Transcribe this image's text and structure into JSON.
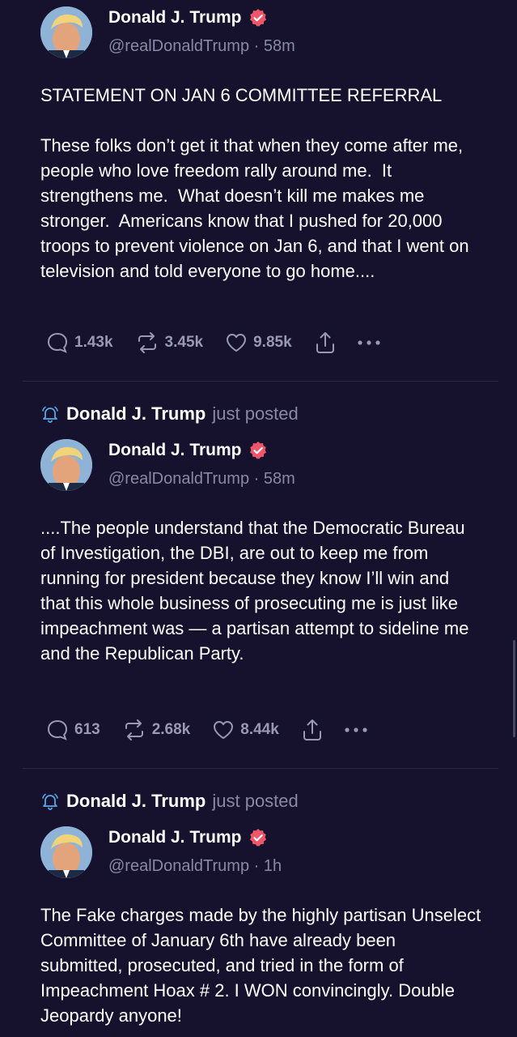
{
  "colors": {
    "background": "#16122e",
    "muted_text": "#8a88a4",
    "action_text": "#9a98b4",
    "verified_badge": "#f0566a",
    "divider": "#2a2646"
  },
  "posts": [
    {
      "author_name": "Donald J. Trump",
      "handle_time": "@realDonaldTrump · 58m",
      "text": "STATEMENT ON JAN 6 COMMITTEE REFERRAL\n\nThese folks don’t get it that when they come after me, people who love freedom rally around me.  It strengthens me.  What doesn’t kill me makes me stronger.  Americans know that I pushed for 20,000 troops to prevent violence on Jan 6, and that I went on television and told everyone to go home....",
      "replies": "1.43k",
      "retruths": "3.45k",
      "likes": "9.85k"
    },
    {
      "notice_name": "Donald J. Trump",
      "notice_action": "just posted",
      "author_name": "Donald J. Trump",
      "handle_time": "@realDonaldTrump · 58m",
      "text": "....The people understand that the Democratic Bureau of Investigation, the DBI, are out to keep me from running for president because they know I’ll win and that this whole business of prosecuting me is just like impeachment was — a partisan attempt to sideline me and the Republican Party.",
      "replies": "613",
      "retruths": "2.68k",
      "likes": "8.44k"
    },
    {
      "notice_name": "Donald J. Trump",
      "notice_action": "just posted",
      "author_name": "Donald J. Trump",
      "handle_time": "@realDonaldTrump · 1h",
      "text": "The Fake charges made by the highly partisan Unselect Committee of January 6th have already been submitted, prosecuted, and tried in the form of Impeachment Hoax # 2. I WON convincingly. Double Jeopardy anyone!"
    }
  ],
  "icons": {
    "reply": "speech-bubble-icon",
    "retruth": "repost-arrows-icon",
    "like": "heart-icon",
    "share": "share-upload-icon",
    "more": "more-dots-icon",
    "notify": "bell-icon",
    "verified": "verified-badge-icon"
  }
}
